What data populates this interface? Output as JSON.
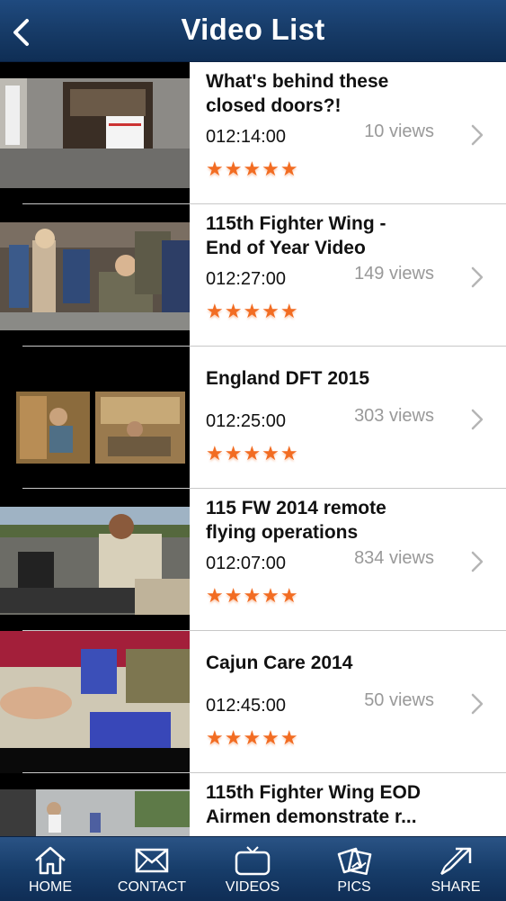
{
  "header": {
    "title": "Video List",
    "back_icon": "chevron-left-icon"
  },
  "videos": [
    {
      "title": "What's behind these\nclosed doors?!",
      "duration": "012:14:00",
      "views": "10 views",
      "rating": "★★★★★"
    },
    {
      "title": "115th Fighter Wing -\nEnd of Year Video",
      "duration": "012:27:00",
      "views": "149 views",
      "rating": "★★★★★"
    },
    {
      "title": "England DFT 2015",
      "duration": "012:25:00",
      "views": "303 views",
      "rating": "★★★★★"
    },
    {
      "title": "115 FW 2014 remote\nflying operations",
      "duration": "012:07:00",
      "views": "834 views",
      "rating": "★★★★★"
    },
    {
      "title": "Cajun Care 2014",
      "duration": "012:45:00",
      "views": "50 views",
      "rating": "★★★★★"
    },
    {
      "title": "115th Fighter Wing EOD\nAirmen demonstrate r...",
      "duration": "",
      "views": "",
      "rating": ""
    }
  ],
  "tabbar": {
    "home": "HOME",
    "contact": "CONTACT",
    "videos": "VIDEOS",
    "pics": "PICS",
    "share": "SHARE"
  },
  "colors": {
    "header": "#163a66",
    "star": "#f26c22",
    "views": "#999999"
  }
}
